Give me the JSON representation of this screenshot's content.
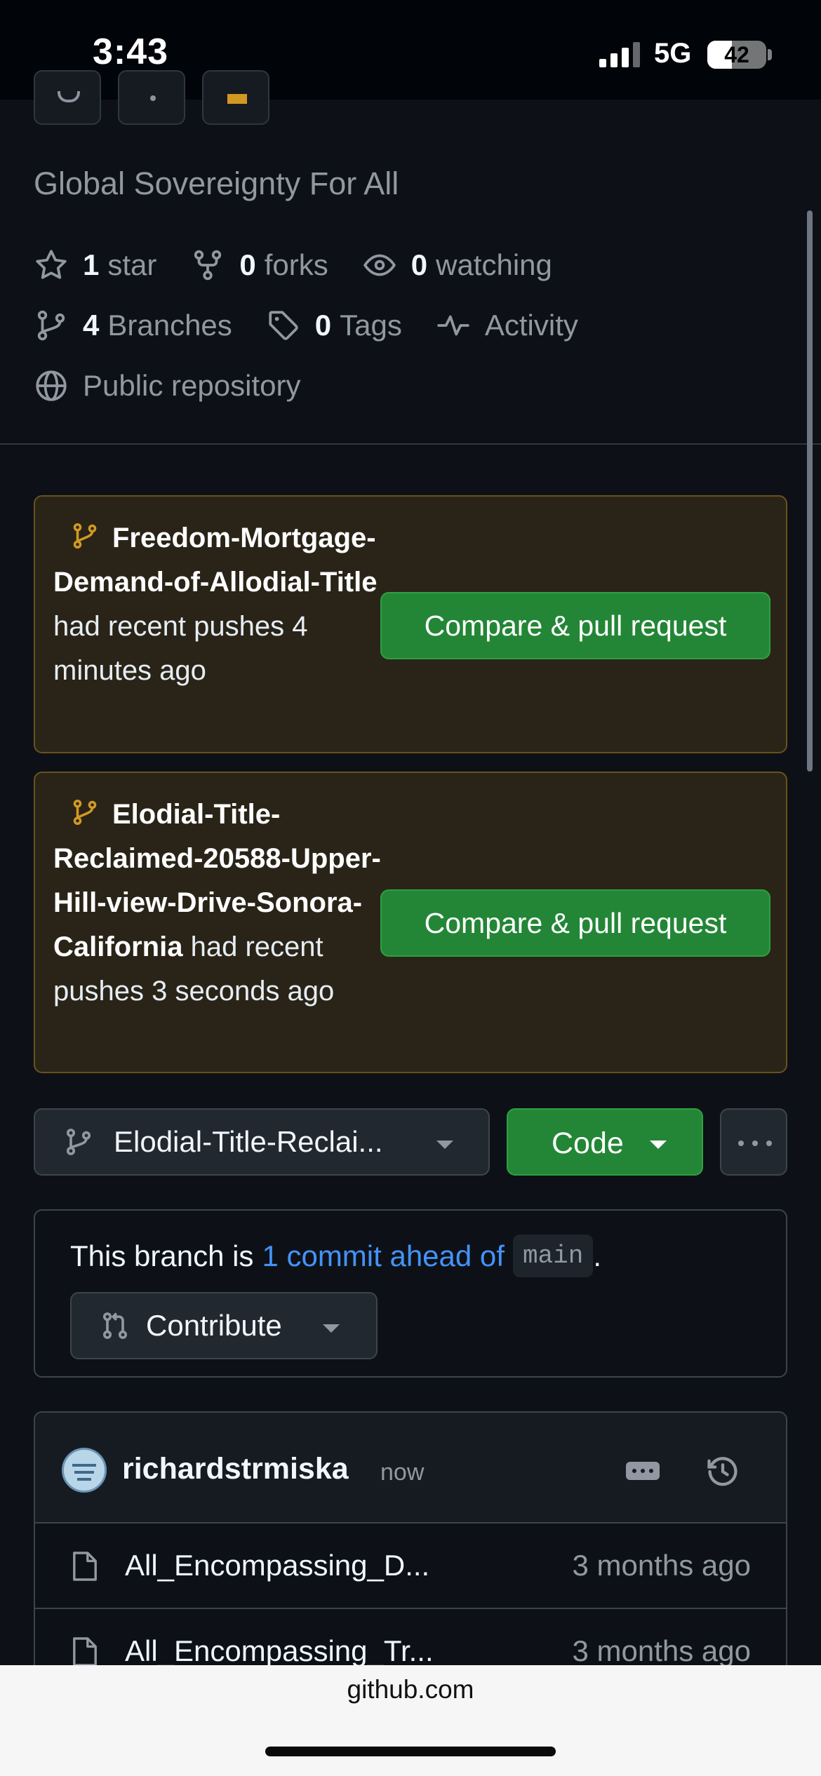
{
  "status_bar": {
    "time": "3:43",
    "network": "5G",
    "battery": "42",
    "battery_level": 0.42
  },
  "repo": {
    "description": "Global Sovereignty For All",
    "stats": {
      "stars_count": "1",
      "stars_label": "star",
      "forks_count": "0",
      "forks_label": "forks",
      "watching_count": "0",
      "watching_label": "watching",
      "branches_count": "4",
      "branches_label": "Branches",
      "tags_count": "0",
      "tags_label": "Tags",
      "activity_label": "Activity",
      "visibility_label": "Public repository"
    }
  },
  "push_banners": [
    {
      "branch": "Freedom-Mortgage-Demand-of-Allodial-Title",
      "message": "had recent pushes 4 minutes ago",
      "button": "Compare & pull request"
    },
    {
      "branch": "Elodial-Title-Reclaimed-20588-Upper-Hill-view-Drive-Sonora-California",
      "message": "had recent pushes 3 seconds ago",
      "button": "Compare & pull request"
    }
  ],
  "branch_bar": {
    "selected_branch": "Elodial-Title-Reclai...",
    "code_button": "Code"
  },
  "ahead_notice": {
    "prefix": "This branch is",
    "link": "1 commit ahead of",
    "base": "main",
    "suffix": ".",
    "contribute_button": "Contribute"
  },
  "latest_commit": {
    "author": "richardstrmiska",
    "time": "now"
  },
  "files": [
    {
      "name": "All_Encompassing_D...",
      "age": "3 months ago"
    },
    {
      "name": "All_Encompassing_Tr...",
      "age": "3 months ago"
    }
  ],
  "browser": {
    "url": "github.com"
  },
  "colors": {
    "background": "#0d1117",
    "accent_green": "#238636",
    "banner_bg": "#2a2418",
    "banner_border": "#6b5219",
    "link_blue": "#4493f8",
    "muted_text": "#9198a1"
  }
}
